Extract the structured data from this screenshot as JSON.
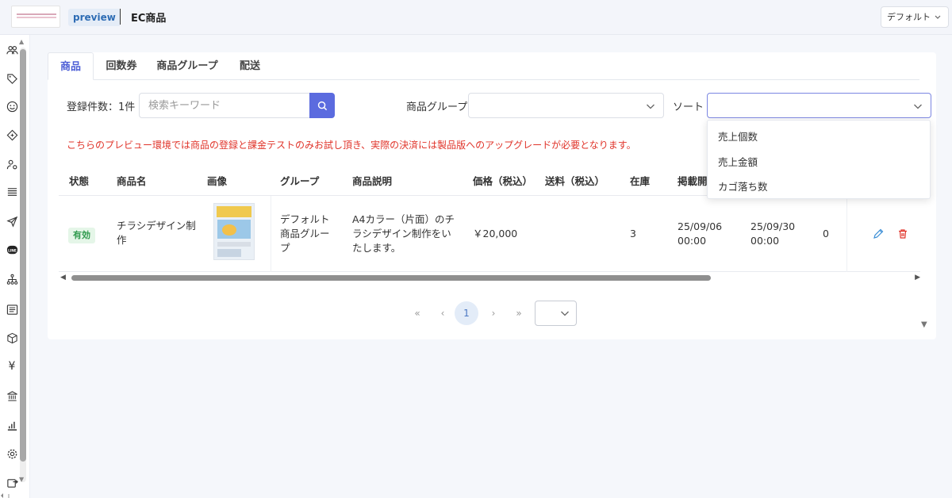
{
  "header": {
    "badge": "preview",
    "title": "EC商品",
    "default_select": "デフォルト"
  },
  "sidebar": {
    "icons": [
      "users-icon",
      "tag-icon",
      "smile-icon",
      "ticket-icon",
      "user-settings-icon",
      "list-icon",
      "send-icon",
      "line-icon",
      "hierarchy-icon",
      "document-icon",
      "box-icon",
      "yen-icon",
      "bank-icon",
      "bar-chart-icon",
      "gear-icon",
      "export-icon"
    ],
    "line_label": "LINE",
    "yen_label": "¥"
  },
  "tabs": [
    {
      "label": "商品",
      "active": true
    },
    {
      "label": "回数券",
      "active": false
    },
    {
      "label": "商品グループ",
      "active": false
    },
    {
      "label": "配送",
      "active": false
    }
  ],
  "filters": {
    "count_label": "登録件数：1件",
    "search_placeholder": "検索キーワード",
    "group_label": "商品グループ",
    "sort_label": "ソート"
  },
  "notice": "こちらのプレビュー環境では商品の登録と課金テストのみお試し頂き、実際の決済には製品版へのアップグレードが必要となります。",
  "table": {
    "columns": [
      "状態",
      "商品名",
      "画像",
      "グループ",
      "商品説明",
      "価格（税込）",
      "送料（税込）",
      "在庫",
      "掲載開"
    ],
    "rows": [
      {
        "status": "有効",
        "name": "チラシデザイン制作",
        "group": "デフォルト商品グループ",
        "description": "A4カラー（片面）のチラシデザイン制作をいたします。",
        "price": "￥20,000",
        "shipping": "",
        "stock": "3",
        "start": "25/09/06 00:00",
        "end": "25/09/30 00:00",
        "extra": "0"
      }
    ]
  },
  "pagination": {
    "first": "«",
    "prev": "‹",
    "current": "1",
    "next": "›",
    "last": "»"
  },
  "sort_dropdown": {
    "options": [
      "売上個数",
      "売上金額",
      "カゴ落ち数"
    ]
  },
  "colors": {
    "accent": "#5b6bdf",
    "notice": "#e0342a",
    "status_green": "#2f9a4d"
  }
}
